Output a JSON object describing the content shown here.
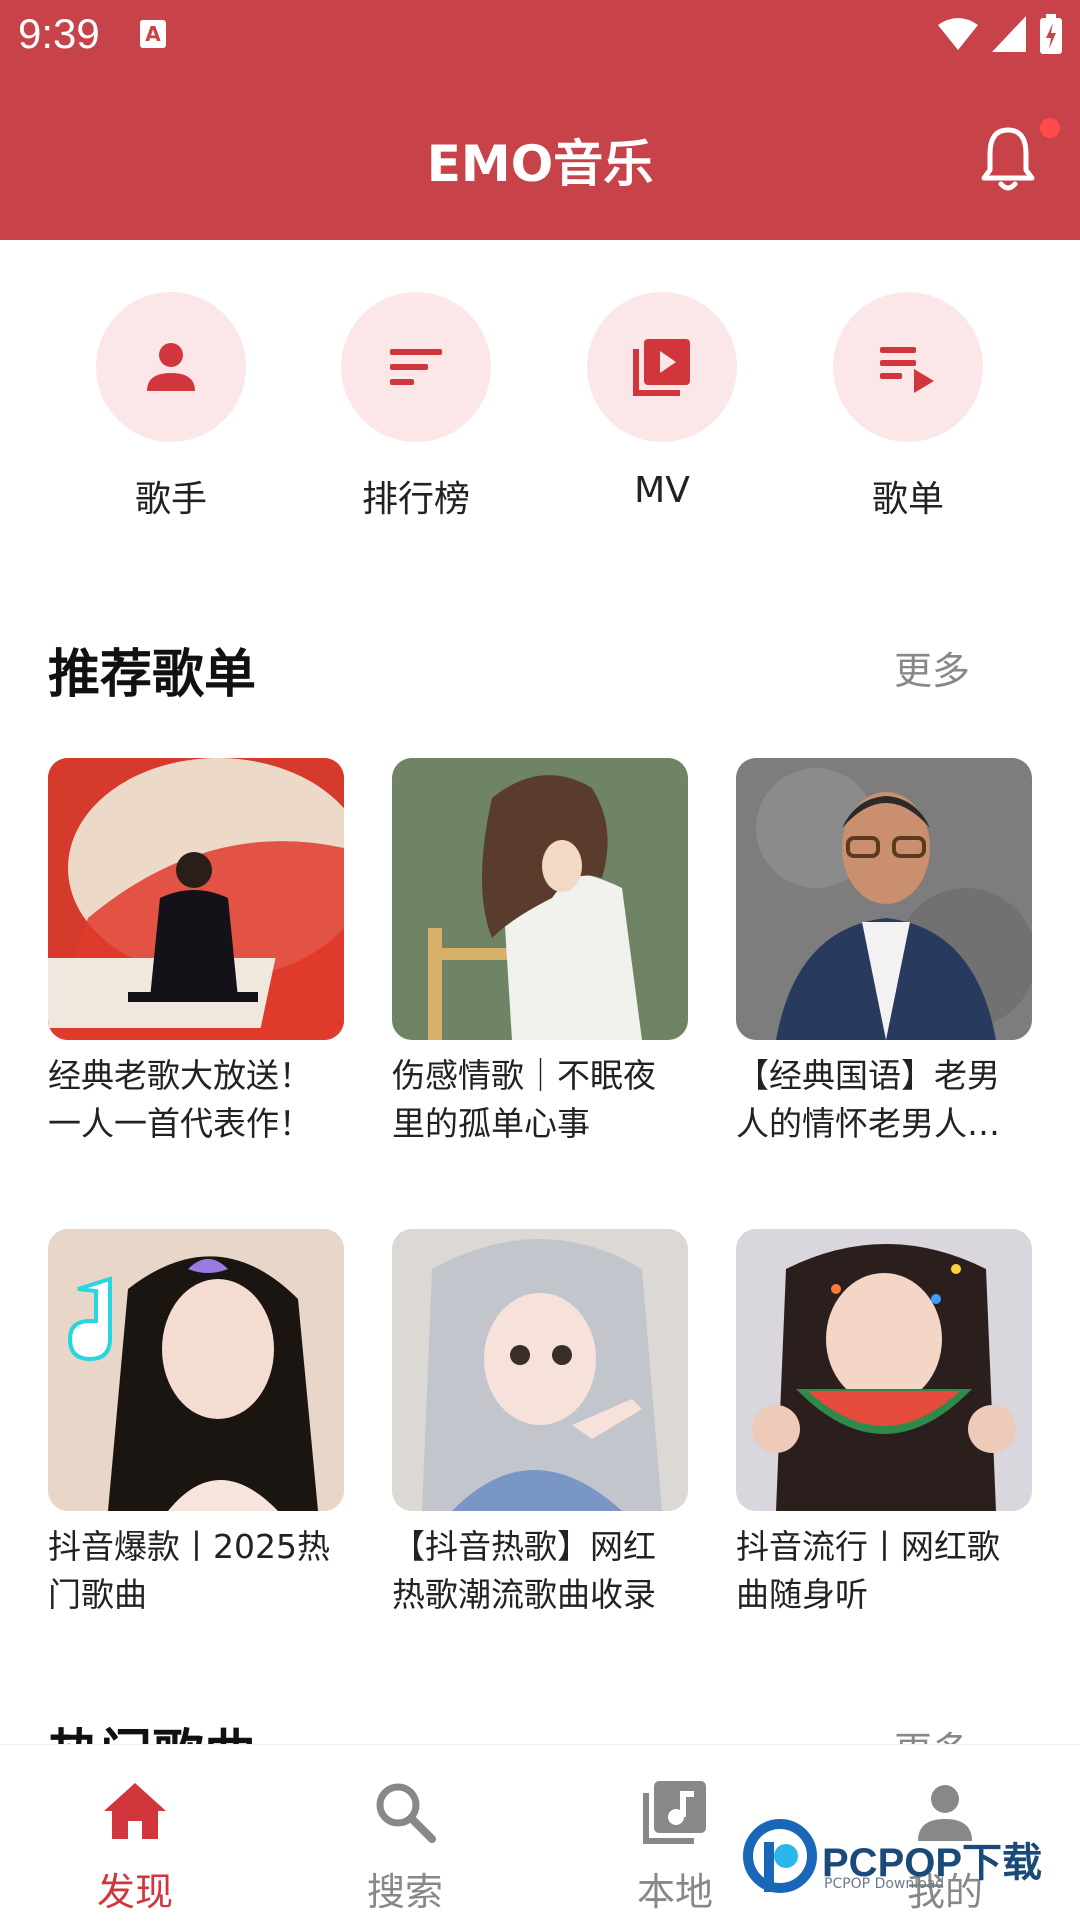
{
  "status": {
    "time": "9:39",
    "a_badge": "A"
  },
  "header": {
    "title": "EMO音乐"
  },
  "quick_nav": [
    {
      "label": "歌手",
      "icon": "person-icon"
    },
    {
      "label": "排行榜",
      "icon": "sort-icon"
    },
    {
      "label": "MV",
      "icon": "video-library-icon"
    },
    {
      "label": "歌单",
      "icon": "playlist-play-icon"
    }
  ],
  "recommended": {
    "title": "推荐歌单",
    "more": "更多",
    "cards": [
      {
        "title": "经典老歌大放送！一人一首代表作！"
      },
      {
        "title": "伤感情歌｜不眠夜里的孤单心事"
      },
      {
        "title": "【经典国语】老男人的情怀老男人的心事"
      },
      {
        "title": "抖音爆款丨2025热门歌曲"
      },
      {
        "title": "【抖音热歌】网红热歌潮流歌曲收录"
      },
      {
        "title": "抖音流行丨网红歌曲随身听"
      }
    ]
  },
  "hot_songs": {
    "title": "热门歌曲",
    "more": "更多"
  },
  "bottom_nav": [
    {
      "label": "发现",
      "icon": "home-icon"
    },
    {
      "label": "搜索",
      "icon": "search-icon"
    },
    {
      "label": "本地",
      "icon": "library-music-icon"
    },
    {
      "label": "我的",
      "icon": "person-icon"
    }
  ],
  "watermark": {
    "text": "PCPOP下载",
    "sub": "PCPOP Download"
  },
  "colors": {
    "brand": "#c84249",
    "accent_light": "#fbe7e8",
    "active": "#d2363d"
  }
}
